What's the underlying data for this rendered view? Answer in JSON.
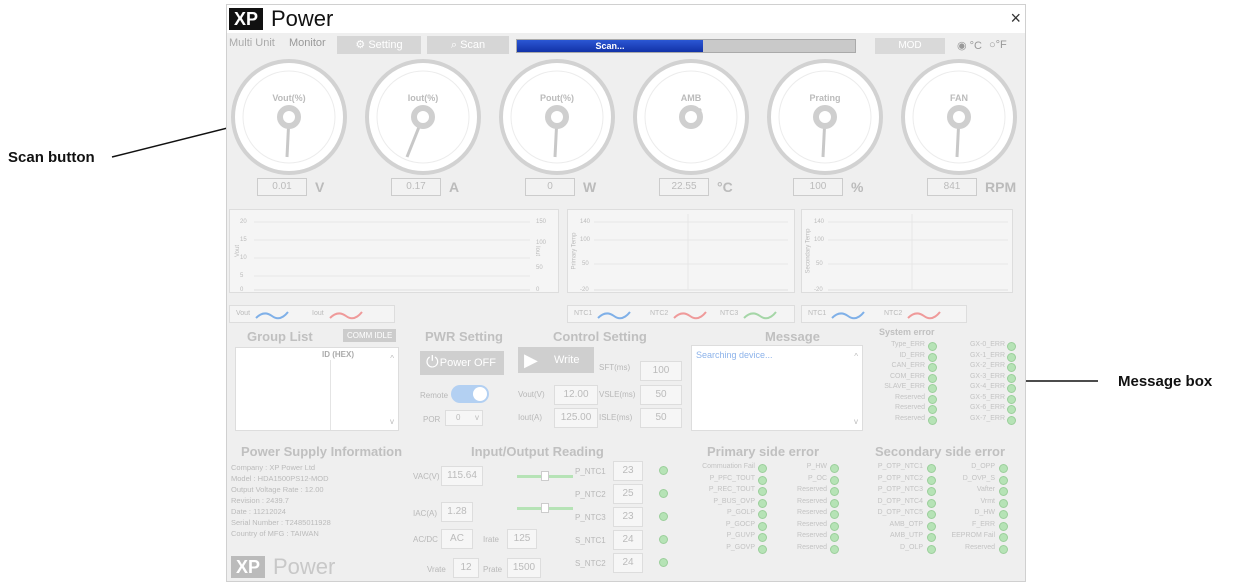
{
  "callouts": {
    "scan": "Scan button",
    "message": "Message box"
  },
  "app": {
    "logo_xp": "XP",
    "logo_power": "Power",
    "close": "×"
  },
  "tabs": {
    "multi_unit": "Multi Unit",
    "monitor": "Monitor",
    "setting": "Setting",
    "scan": "Scan"
  },
  "progress": {
    "label": "Scan...",
    "fraction": 0.55
  },
  "mod_label": "MOD",
  "temp_units": {
    "c": "°C",
    "f": "°F",
    "selected": "°C"
  },
  "gauges": [
    {
      "name": "Vout(%)",
      "value": "0.01",
      "unit": "V"
    },
    {
      "name": "Iout(%)",
      "value": "0.17",
      "unit": "A"
    },
    {
      "name": "Pout(%)",
      "value": "0",
      "unit": "W"
    },
    {
      "name": "AMB",
      "value": "22.55",
      "unit": "°C"
    },
    {
      "name": "Prating",
      "value": "100",
      "unit": "%"
    },
    {
      "name": "FAN",
      "value": "841",
      "unit": "RPM"
    }
  ],
  "charts": {
    "c1": {
      "yl": "Vout",
      "yr": "Iout",
      "ticks_l": [
        "20",
        "15",
        "10",
        "5",
        "0"
      ],
      "ticks_r": [
        "150",
        "100",
        "50",
        "0"
      ]
    },
    "c2": {
      "yl": "Primary Temp",
      "ticks": [
        "140",
        "100",
        "50",
        "",
        "-20"
      ]
    },
    "c3": {
      "yl": "Secondary Temp",
      "ticks": [
        "140",
        "100",
        "50",
        "",
        "-20"
      ]
    }
  },
  "legends": {
    "l1": [
      "Vout",
      "Iout"
    ],
    "l2": [
      "NTC1",
      "NTC2",
      "NTC3"
    ],
    "l3": [
      "NTC1",
      "NTC2"
    ]
  },
  "group_list": {
    "title": "Group List",
    "badge": "COMM IDLE",
    "col": "ID (HEX)"
  },
  "pwr": {
    "title": "PWR Setting",
    "button": "Power OFF",
    "remote": "Remote",
    "por": "POR",
    "por_val": "0"
  },
  "control": {
    "title": "Control Setting",
    "write": "Write",
    "vout_l": "Vout(V)",
    "vout": "12.00",
    "iout_l": "Iout(A)",
    "iout": "125.00",
    "sft_l": "SFT(ms)",
    "sft": "100",
    "vsle_l": "VSLE(ms)",
    "vsle": "50",
    "isle_l": "ISLE(ms)",
    "isle": "50"
  },
  "message": {
    "title": "Message",
    "text": "Searching device..."
  },
  "system_error": {
    "title": "System error",
    "left": [
      "Type_ERR",
      "ID_ERR",
      "CAN_ERR",
      "COM_ERR",
      "SLAVE_ERR",
      "Reserved",
      "Reserved",
      "Reserved"
    ],
    "right": [
      "GX-0_ERR",
      "GX-1_ERR",
      "GX-2_ERR",
      "GX-3_ERR",
      "GX-4_ERR",
      "GX-5_ERR",
      "GX-6_ERR",
      "GX-7_ERR"
    ]
  },
  "ps_info": {
    "title": "Power Supply Information",
    "lines": [
      "Company : XP Power Ltd",
      "Model : HDA1500PS12-MOD",
      "Output Voltage Rate : 12.00",
      "Revision : 2439.7",
      "Date : 11212024",
      "Serial Number : T2485011928",
      "Country of MFG : TAIWAN"
    ]
  },
  "io": {
    "title": "Input/Output Reading",
    "vac_l": "VAC(V)",
    "vac": "115.64",
    "iac_l": "IAC(A)",
    "iac": "1.28",
    "acdc_l": "AC/DC",
    "acdc": "AC",
    "irate_l": "Irate",
    "irate": "125",
    "vrate_l": "Vrate",
    "vrate": "12",
    "prate_l": "Prate",
    "prate": "1500",
    "ntc": [
      {
        "l": "P_NTC1",
        "v": "23"
      },
      {
        "l": "P_NTC2",
        "v": "25"
      },
      {
        "l": "P_NTC3",
        "v": "23"
      },
      {
        "l": "S_NTC1",
        "v": "24"
      },
      {
        "l": "S_NTC2",
        "v": "24"
      }
    ]
  },
  "primary_error": {
    "title": "Primary side error",
    "left": [
      "Commuation Fail",
      "P_PFC_TOUT",
      "P_REC_TOUT",
      "P_BUS_OVP",
      "P_GOLP",
      "P_GOCP",
      "P_GUVP",
      "P_GOVP"
    ],
    "right": [
      "P_HW",
      "P_OC",
      "Reserved",
      "Reserved",
      "Reserved",
      "Reserved",
      "Reserved",
      "Reserved"
    ]
  },
  "secondary_error": {
    "title": "Secondary side error",
    "left": [
      "P_OTP_NTC1",
      "P_OTP_NTC2",
      "P_OTP_NTC3",
      "D_OTP_NTC4",
      "D_OTP_NTC5",
      "AMB_OTP",
      "AMB_UTP",
      "D_OLP"
    ],
    "right": [
      "D_OPP",
      "D_OVP_S",
      "Vafter",
      "Vrmt",
      "D_HW",
      "F_ERR",
      "EEPROM Fail",
      "Reserved"
    ]
  },
  "footer_logo": {
    "xp": "XP",
    "power": "Power"
  }
}
